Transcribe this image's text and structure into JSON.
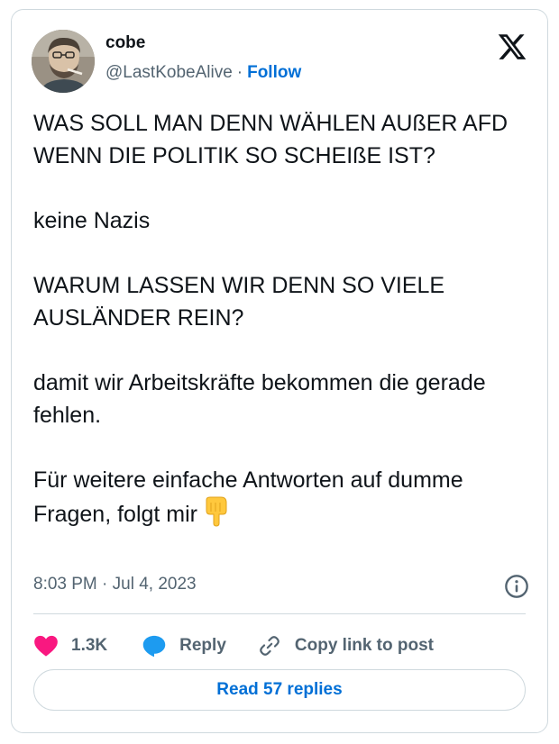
{
  "author": {
    "display_name": "cobe",
    "handle": "@LastKobeAlive",
    "separator": "·",
    "follow_label": "Follow",
    "avatar_icon": "user-avatar-photo"
  },
  "platform_icon": "x-logo-icon",
  "tweet": {
    "paragraphs": [
      "WAS SOLL MAN DENN WÄHLEN AUßER AFD WENN DIE POLITIK SO SCHEIßE IST?",
      "keine Nazis",
      "WARUM LASSEN WIR DENN SO VIELE AUSLÄNDER REIN?",
      "damit wir Arbeitskräfte bekommen die gerade fehlen.",
      "Für weitere einfache Antworten auf dumme Fragen, folgt mir"
    ],
    "trailing_emoji": "👇"
  },
  "timestamp": "8:03 PM · Jul 4, 2023",
  "actions": {
    "like_count": "1.3K",
    "reply_label": "Reply",
    "copy_link_label": "Copy link to post"
  },
  "read_replies_label": "Read 57 replies",
  "colors": {
    "accent": "#006fd6",
    "like": "#f91880",
    "reply_icon": "#1d9bf0",
    "secondary_text": "#536471",
    "border": "#cfd9de"
  }
}
